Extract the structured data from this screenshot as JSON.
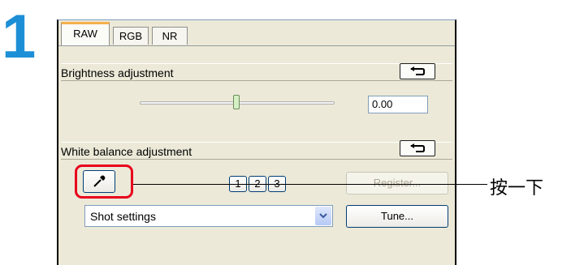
{
  "step": {
    "number": "1"
  },
  "tabs": [
    {
      "label": "RAW",
      "active": true
    },
    {
      "label": "RGB",
      "active": false
    },
    {
      "label": "NR",
      "active": false
    }
  ],
  "brightness": {
    "title": "Brightness adjustment",
    "value": "0.00",
    "slider_fraction": 0.5,
    "reset_icon": "undo-icon"
  },
  "white_balance": {
    "title": "White balance adjustment",
    "reset_icon": "undo-icon",
    "eyedropper_icon": "eyedropper-icon",
    "preset_buttons": [
      "1",
      "2",
      "3"
    ],
    "register_label": "Register...",
    "select_value": "Shot settings",
    "tune_label": "Tune..."
  },
  "callout": {
    "text": "按一下"
  },
  "colors": {
    "step_blue": "#1d8fd6",
    "highlight_red": "#e8001c",
    "tab_accent": "#f5b14c"
  }
}
